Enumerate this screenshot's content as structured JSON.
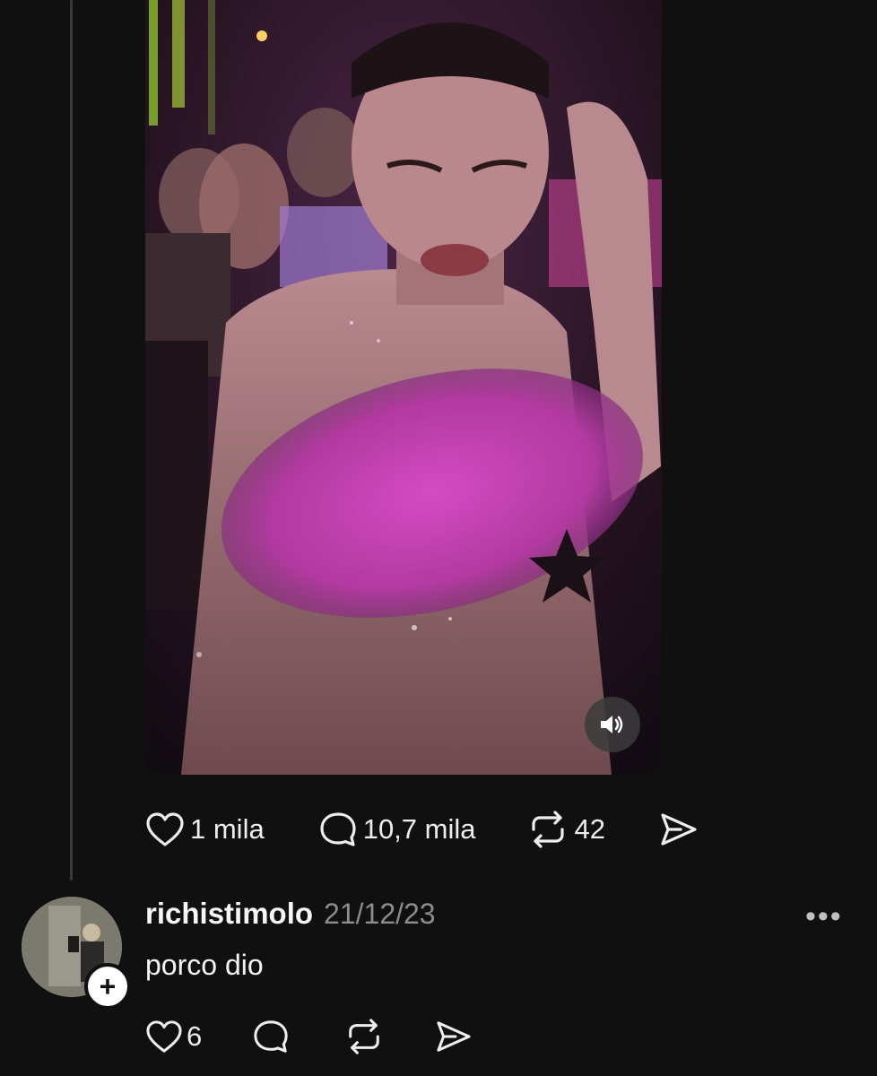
{
  "post": {
    "actions": {
      "likes": "1 mila",
      "comments": "10,7 mila",
      "reposts": "42"
    }
  },
  "reply": {
    "username": "richistimolo",
    "date": "21/12/23",
    "text": "porco dio",
    "likes": "6"
  },
  "icons": {
    "like": "heart-icon",
    "comment": "comment-bubble-icon",
    "repost": "repost-icon",
    "share": "send-icon",
    "sound": "speaker-icon",
    "follow": "plus-icon",
    "more": "more-options-icon"
  }
}
